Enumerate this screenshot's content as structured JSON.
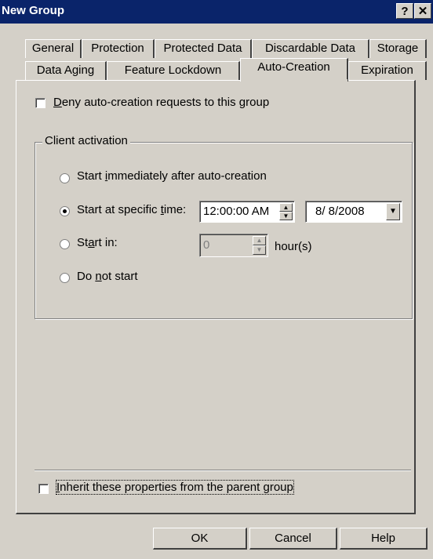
{
  "window": {
    "title": "New Group",
    "help_glyph": "?",
    "close_glyph": "✕"
  },
  "tabs_row1": [
    "General",
    "Protection",
    "Protected Data",
    "Discardable Data",
    "Storage"
  ],
  "tabs_row2": [
    "Data Aging",
    "Feature Lockdown",
    "Auto-Creation",
    "Expiration"
  ],
  "active_tab": "Auto-Creation",
  "deny": {
    "pre": "",
    "accel": "D",
    "post": "eny auto-creation requests to this group",
    "checked": false
  },
  "client_activation": {
    "label": "Client activation",
    "immediately": {
      "pre": "Start ",
      "accel": "i",
      "post": "mmediately after auto-creation",
      "selected": false
    },
    "specific": {
      "pre": "Start at specific ",
      "accel": "t",
      "post": "ime:",
      "selected": true
    },
    "time_value": "12:00:00 AM",
    "date_value": "8/  8/2008",
    "start_in": {
      "pre": "St",
      "accel": "a",
      "post": "rt in:",
      "selected": false
    },
    "hours_value": "0",
    "hours_unit": "hour(s)",
    "do_not_start": {
      "pre": "Do ",
      "accel": "n",
      "post": "ot start",
      "selected": false
    }
  },
  "inherit": {
    "pre": "",
    "accel": "I",
    "post": "nherit these properties from the parent group",
    "checked": false
  },
  "buttons": {
    "ok": "OK",
    "cancel": "Cancel",
    "help": "Help"
  }
}
